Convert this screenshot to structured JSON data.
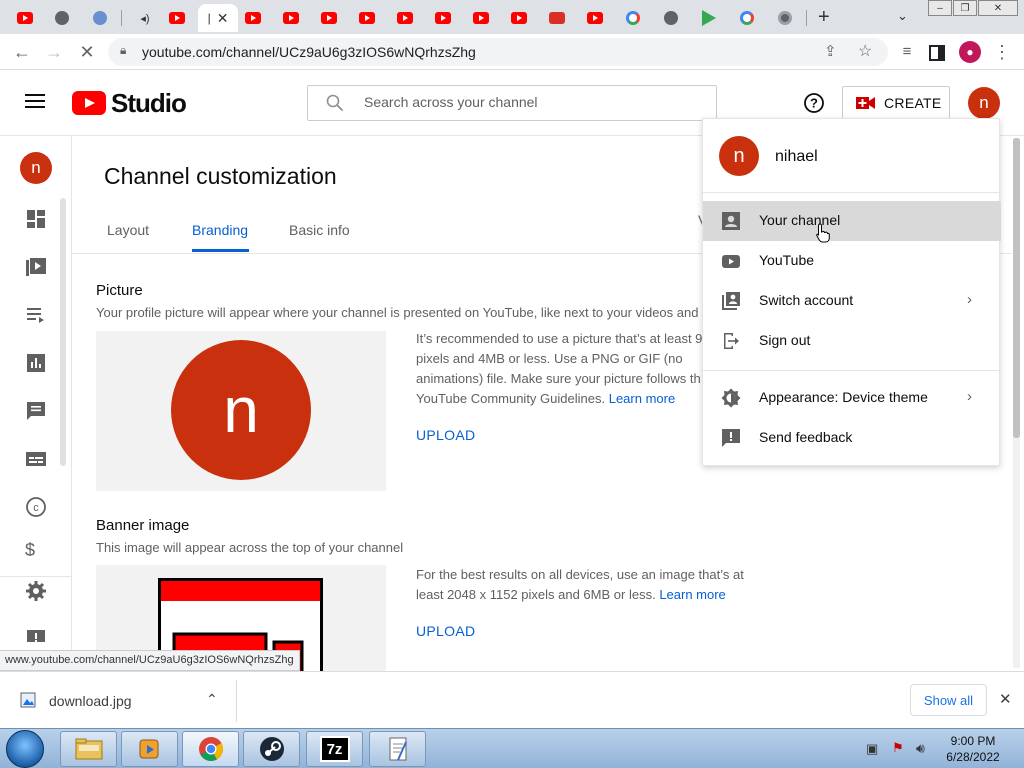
{
  "browser": {
    "url": "youtube.com/channel/UCz9aU6g3zIOS6wNQrhzsZhg",
    "status_url": "www.youtube.com/channel/UCz9aU6g3zIOS6wNQrhzsZhg"
  },
  "header": {
    "brand": "Studio",
    "search_placeholder": "Search across your channel",
    "create_label": "CREATE",
    "avatar_letter": "n"
  },
  "page": {
    "title": "Channel customization",
    "tabs": [
      {
        "label": "Layout"
      },
      {
        "label": "Branding"
      },
      {
        "label": "Basic info"
      }
    ],
    "active_tab": "Branding"
  },
  "picture": {
    "title": "Picture",
    "desc": "Your profile picture will appear where your channel is presented on YouTube, like next to your videos and c",
    "avatar_letter": "n",
    "help": "It’s recommended to use a picture that’s at least 9 pixels and 4MB or less. Use a PNG or GIF (no animations) file. Make sure your picture follows th YouTube Community Guidelines.",
    "learn_more": "Learn more",
    "upload": "UPLOAD"
  },
  "banner": {
    "title": "Banner image",
    "desc": "This image will appear across the top of your channel",
    "help": "For the best results on all devices, use an image that’s at least 2048 x 1152 pixels and 6MB or less.",
    "learn_more": "Learn more",
    "upload": "UPLOAD"
  },
  "account_menu": {
    "user_name": "nihael",
    "avatar_letter": "n",
    "items": [
      {
        "label": "Your channel",
        "icon": "person-box-icon",
        "hovered": true
      },
      {
        "label": "YouTube",
        "icon": "youtube-icon"
      },
      {
        "label": "Switch account",
        "icon": "switch-account-icon",
        "has_submenu": true
      },
      {
        "label": "Sign out",
        "icon": "sign-out-icon"
      },
      {
        "label": "Appearance: Device theme",
        "icon": "appearance-icon",
        "has_submenu": true
      },
      {
        "label": "Send feedback",
        "icon": "feedback-icon"
      }
    ]
  },
  "sidebar": {
    "avatar_letter": "n"
  },
  "downloads": {
    "file_name": "download.jpg",
    "show_all": "Show all"
  },
  "taskbar": {
    "time": "9:00 PM",
    "date": "6/28/2022",
    "seven_zip": "7z"
  },
  "colors": {
    "accent_blue": "#065fd4",
    "avatar": "#c8300e",
    "youtube_red": "#ff0000"
  }
}
